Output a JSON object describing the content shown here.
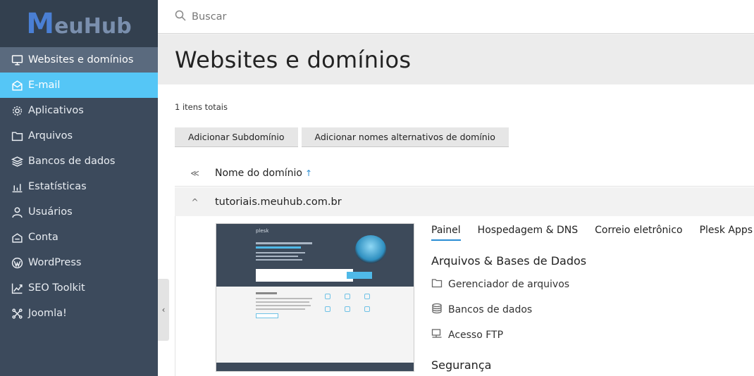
{
  "brand": {
    "logo_text": "euHub"
  },
  "sidebar": {
    "items": [
      {
        "label": "Websites e domínios",
        "icon": "monitor-icon"
      },
      {
        "label": "E-mail",
        "icon": "mail-icon"
      },
      {
        "label": "Aplicativos",
        "icon": "gear-icon"
      },
      {
        "label": "Arquivos",
        "icon": "folder-icon"
      },
      {
        "label": "Bancos de dados",
        "icon": "layers-icon"
      },
      {
        "label": "Estatísticas",
        "icon": "bar-chart-icon"
      },
      {
        "label": "Usuários",
        "icon": "user-icon"
      },
      {
        "label": "Conta",
        "icon": "account-icon"
      },
      {
        "label": "WordPress",
        "icon": "wordpress-icon"
      },
      {
        "label": "SEO Toolkit",
        "icon": "seo-chart-icon"
      },
      {
        "label": "Joomla!",
        "icon": "joomla-icon"
      }
    ],
    "collapse_glyph": "‹"
  },
  "search": {
    "placeholder": "Buscar"
  },
  "page": {
    "title": "Websites e domínios"
  },
  "list": {
    "total_text": "1 itens totais",
    "buttons": {
      "add_subdomain": "Adicionar Subdomínio",
      "add_alias": "Adicionar nomes alternativos de domínio"
    },
    "column_header": "Nome do domínio",
    "sort_glyph": "↑",
    "collapse_all_glyph": "≪",
    "row_toggle_glyph": "^"
  },
  "domain": {
    "name": "tutoriais.meuhub.com.br",
    "tabs": [
      "Painel",
      "Hospedagem & DNS",
      "Correio eletrônico",
      "Plesk Apps"
    ],
    "active_tab": "Painel",
    "sections": {
      "files_title": "Arquivos & Bases de Dados",
      "file_manager": "Gerenciador de arquivos",
      "databases": "Bancos de dados",
      "ftp": "Acesso FTP",
      "security_title": "Segurança"
    },
    "preview": {
      "plesk_label": "plesk"
    }
  },
  "colors": {
    "sidebar_bg": "#3c4a5c",
    "selected": "#55c6f6",
    "accent": "#2a8dd4"
  }
}
